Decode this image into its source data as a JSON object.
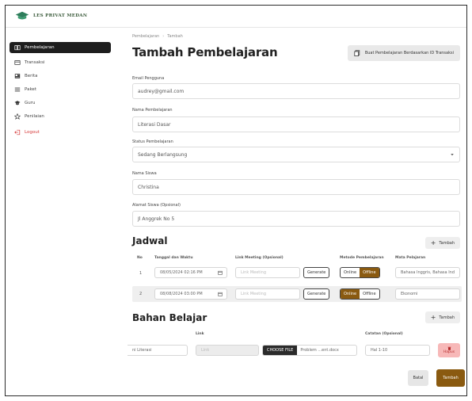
{
  "brand": {
    "name": "LES PRIVAT MEDAN"
  },
  "sidebar": {
    "items": [
      {
        "label": "Pembelajaran",
        "icon": "book-icon",
        "active": true
      },
      {
        "label": "Transaksi",
        "icon": "receipt-icon"
      },
      {
        "label": "Berita",
        "icon": "newspaper-icon"
      },
      {
        "label": "Paket",
        "icon": "list-icon"
      },
      {
        "label": "Guru",
        "icon": "graduation-cap-icon"
      },
      {
        "label": "Penilaian",
        "icon": "star-icon"
      }
    ],
    "logout": {
      "label": "Logout",
      "icon": "logout-icon",
      "color": "#d63a3a"
    }
  },
  "breadcrumb": {
    "parent": "Pembelajaran",
    "current": "Tambah"
  },
  "page": {
    "title": "Tambah Pembelajaran",
    "id_button": "Buat Pembelajaran Berdasarkan ID Transaksi"
  },
  "form": {
    "email": {
      "label": "Email Pengguna",
      "value": "audrey@gmail.com"
    },
    "nama_pembelajaran": {
      "label": "Nama Pembelajaran",
      "value": "Literasi Dasar"
    },
    "status": {
      "label": "Status Pembelajaran",
      "value": "Sedang Berlangsung"
    },
    "nama_siswa": {
      "label": "Nama Siswa",
      "value": "Christina"
    },
    "alamat": {
      "label": "Alamat Siswa (Opsional)",
      "value": "Jl Anggrek No 5"
    }
  },
  "jadwal": {
    "title": "Jadwal",
    "add_label": "Tambah",
    "headers": {
      "no": "No",
      "tanggal": "Tanggal dan Waktu",
      "link": "Link Meeting (Opsional)",
      "metode": "Metode Pembelajaran",
      "mapel": "Mata Pelajaran"
    },
    "generate_label": "Generate",
    "online_label": "Online",
    "offline_label": "Offline",
    "rows": [
      {
        "no": "1",
        "datetime": "08/05/2024 02:16 PM",
        "link_placeholder": "Link Meeting",
        "mode": "Offline",
        "mapel": "Bahasa Inggris, Bahasa Ind"
      },
      {
        "no": "2",
        "datetime": "08/08/2024 03:00 PM",
        "link_placeholder": "Link Meeting",
        "mode": "Online",
        "mapel": "Ekonomi"
      }
    ]
  },
  "bahan": {
    "title": "Bahan Belajar",
    "add_label": "Tambah",
    "headers": {
      "link": "Link",
      "catatan": "Catatan (Opsional)"
    },
    "rows": [
      {
        "nama": "ni Literasi",
        "link_placeholder": "Link",
        "file_button": "CHOOSE FILE",
        "file_name": "Problem ...ent.docx",
        "catatan": "Hal 1-10",
        "hapus_label": "Hapus"
      }
    ]
  },
  "actions": {
    "cancel": "Batal",
    "submit": "Tambah"
  },
  "colors": {
    "accent": "#8a5a10",
    "danger": "#d63a3a",
    "sidebar_active": "#1e1e1e"
  }
}
